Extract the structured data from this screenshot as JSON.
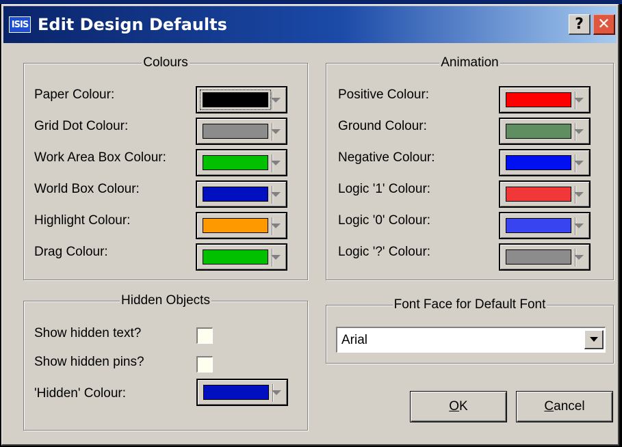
{
  "window": {
    "title": "Edit Design Defaults",
    "app_icon_text": "ISIS",
    "help_glyph": "?",
    "close_glyph": "✕"
  },
  "colours": {
    "title": "Colours",
    "items": [
      {
        "label": "Paper Colour:",
        "color": "#000000"
      },
      {
        "label": "Grid Dot Colour:",
        "color": "#8c8c8c"
      },
      {
        "label": "Work Area Box Colour:",
        "color": "#00c000"
      },
      {
        "label": "World Box Colour:",
        "color": "#0010c0"
      },
      {
        "label": "Highlight Colour:",
        "color": "#ff9900"
      },
      {
        "label": "Drag Colour:",
        "color": "#00c000"
      }
    ]
  },
  "animation": {
    "title": "Animation",
    "items": [
      {
        "label": "Positive Colour:",
        "color": "#ff0000"
      },
      {
        "label": "Ground Colour:",
        "color": "#5f8f60"
      },
      {
        "label": "Negative Colour:",
        "color": "#0010f0"
      },
      {
        "label": "Logic '1' Colour:",
        "color": "#f03838"
      },
      {
        "label": "Logic '0' Colour:",
        "color": "#3844f0"
      },
      {
        "label": "Logic '?' Colour:",
        "color": "#8c8c8c"
      }
    ]
  },
  "hidden_objects": {
    "title": "Hidden Objects",
    "show_text_label": "Show hidden text?",
    "show_text_checked": false,
    "show_pins_label": "Show hidden pins?",
    "show_pins_checked": false,
    "hidden_colour_label": "'Hidden' Colour:",
    "hidden_colour": "#0010c0"
  },
  "font_face": {
    "title": "Font Face for Default Font",
    "value": "Arial"
  },
  "buttons": {
    "ok_mnemonic": "O",
    "ok_rest": "K",
    "cancel_mnemonic": "C",
    "cancel_rest": "ancel"
  }
}
